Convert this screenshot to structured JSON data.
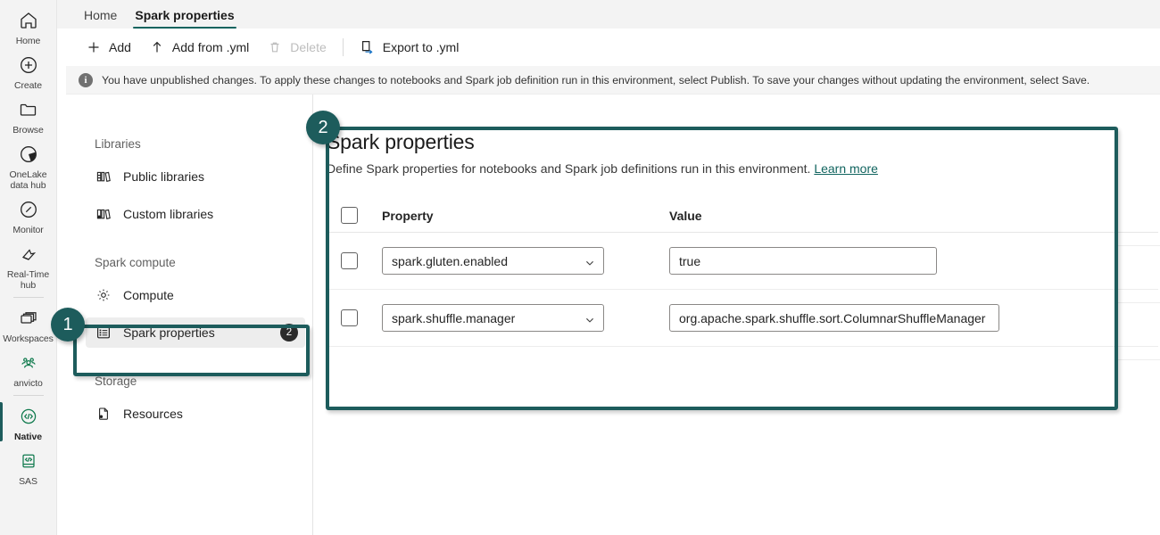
{
  "rail": {
    "items": [
      {
        "label": "Home",
        "icon": "home-icon",
        "active": false
      },
      {
        "label": "Create",
        "icon": "plus-circle-icon",
        "active": false
      },
      {
        "label": "Browse",
        "icon": "folder-icon",
        "active": false
      },
      {
        "label": "OneLake\ndata hub",
        "icon": "onelake-icon",
        "active": false
      },
      {
        "label": "Monitor",
        "icon": "monitor-icon",
        "active": false
      },
      {
        "label": "Real-Time\nhub",
        "icon": "realtime-hub-icon",
        "active": false
      },
      {
        "label": "Workspaces",
        "icon": "workspaces-icon",
        "active": false
      },
      {
        "label": "anvicto",
        "icon": "people-group-icon",
        "active": false
      },
      {
        "label": "Native",
        "icon": "code-circle-icon",
        "active": true
      },
      {
        "label": "SAS",
        "icon": "code-book-icon",
        "active": false
      }
    ]
  },
  "tabs": [
    {
      "label": "Home",
      "active": false
    },
    {
      "label": "Spark properties",
      "active": true
    }
  ],
  "toolbar": {
    "add_label": "Add",
    "add_from_yml_label": "Add from .yml",
    "delete_label": "Delete",
    "export_label": "Export to .yml"
  },
  "notice": {
    "icon": "info-icon",
    "text": "You have unpublished changes. To apply these changes to notebooks and Spark job definition run in this environment, select Publish. To save your changes without updating the environment, select Save."
  },
  "sidebar": {
    "groups": [
      {
        "title": "Libraries",
        "items": [
          {
            "label": "Public libraries",
            "icon": "public-libraries-icon",
            "selected": false,
            "badge": ""
          },
          {
            "label": "Custom libraries",
            "icon": "custom-libraries-icon",
            "selected": false,
            "badge": ""
          }
        ]
      },
      {
        "title": "Spark compute",
        "items": [
          {
            "label": "Compute",
            "icon": "gear-icon",
            "selected": false,
            "badge": ""
          },
          {
            "label": "Spark properties",
            "icon": "list-icon",
            "selected": true,
            "badge": "2"
          }
        ]
      },
      {
        "title": "Storage",
        "items": [
          {
            "label": "Resources",
            "icon": "resources-icon",
            "selected": false,
            "badge": ""
          }
        ]
      }
    ]
  },
  "main": {
    "title": "Spark properties",
    "subtitle": "Define Spark properties for notebooks and Spark job definitions run in this environment.",
    "learn_more": "Learn more",
    "table": {
      "columns": [
        "Property",
        "Value"
      ],
      "rows": [
        {
          "property": "spark.gluten.enabled",
          "value": "true"
        },
        {
          "property": "spark.shuffle.manager",
          "value": "org.apache.spark.shuffle.sort.ColumnarShuffleManager"
        }
      ]
    }
  },
  "annotations": [
    {
      "number": "1",
      "target": "spark-properties-sidebar-item"
    },
    {
      "number": "2",
      "target": "spark-properties-panel"
    }
  ],
  "colors": {
    "accent_teal": "#1d5c5c",
    "tab_underline": "#11645f",
    "link": "#11645f",
    "badge_dark": "#2b2b2b",
    "export_arrow_blue": "#1572c6",
    "native_green": "#0f7a4d"
  }
}
